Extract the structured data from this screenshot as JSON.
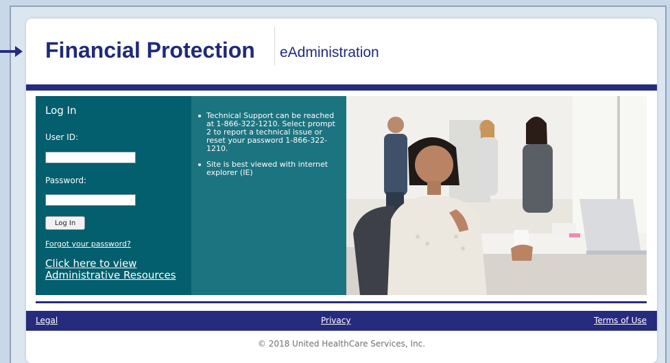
{
  "header": {
    "title": "Financial Protection",
    "subtitle": "eAdministration"
  },
  "login": {
    "title": "Log In",
    "user_id_label": "User ID:",
    "user_id_value": "",
    "password_label": "Password:",
    "password_value": "",
    "login_button": "Log In",
    "forgot_link": "Forgot your password?",
    "resources_link": "Click here to view Administrative Resources"
  },
  "info": {
    "items": [
      "Technical Support can be reached at 1-866-322-1210. Select prompt 2 to report a technical issue or reset your password 1-866-322-1210.",
      "Site is best viewed with internet explorer (IE)"
    ]
  },
  "footer": {
    "legal": "Legal",
    "privacy": "Privacy",
    "terms": "Terms of Use",
    "copyright": "© 2018 United HealthCare Services, Inc."
  },
  "colors": {
    "navy": "#262b7e",
    "brand_text": "#1f2a7a",
    "login_panel": "#035e6d",
    "info_panel": "#1c7480"
  }
}
